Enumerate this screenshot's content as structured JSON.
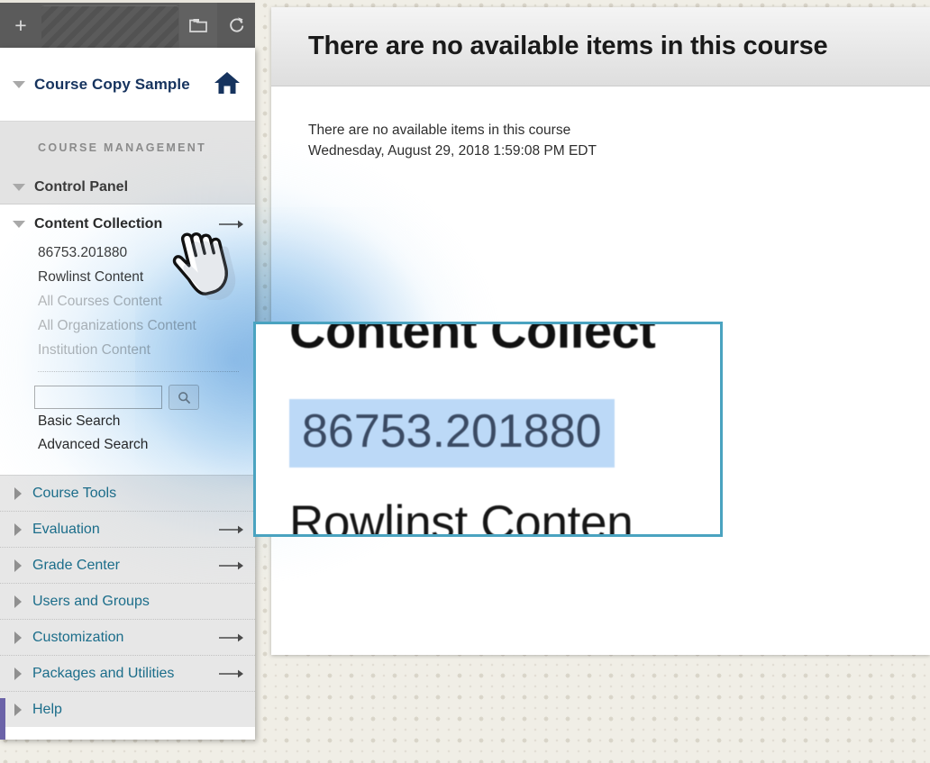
{
  "browser_chrome": {
    "new_tab_label": "+",
    "folder_icon": "folder-icon",
    "reload_icon": "reload-icon"
  },
  "sidebar": {
    "course_title": "Course Copy Sample",
    "home_icon": "home-icon",
    "course_management_label": "COURSE MANAGEMENT",
    "control_panel_label": "Control Panel",
    "content_collection": {
      "label": "Content Collection",
      "items": [
        {
          "label": "86753.201880",
          "dim": false
        },
        {
          "label": "Rowlinst Content",
          "dim": false
        },
        {
          "label": "All Courses Content",
          "dim": true
        },
        {
          "label": "All Organizations Content",
          "dim": true
        },
        {
          "label": "Institution Content",
          "dim": true
        }
      ],
      "search_value": "",
      "search_placeholder": "",
      "search_icon": "search-icon",
      "basic_search_label": "Basic Search",
      "advanced_search_label": "Advanced Search"
    },
    "nav_groups": [
      {
        "label": "Course Tools",
        "has_arrow": false
      },
      {
        "label": "Evaluation",
        "has_arrow": true
      },
      {
        "label": "Grade Center",
        "has_arrow": true
      },
      {
        "label": "Users and Groups",
        "has_arrow": false
      },
      {
        "label": "Customization",
        "has_arrow": true
      },
      {
        "label": "Packages and Utilities",
        "has_arrow": true
      },
      {
        "label": "Help",
        "has_arrow": false
      }
    ]
  },
  "main": {
    "heading": "There are no available items in this course",
    "body_line_1": "There are no available items in this course",
    "body_line_2": "Wednesday, August 29, 2018 1:59:08 PM EDT"
  },
  "magnifier": {
    "line_top": "Content Collect",
    "line_highlight": "86753.201880",
    "line_bottom": "Rowlinst Conten",
    "border_color": "#4aa3c0",
    "highlight_color": "#bcd9f7"
  },
  "cursor": {
    "icon": "pointing-hand-cursor"
  }
}
